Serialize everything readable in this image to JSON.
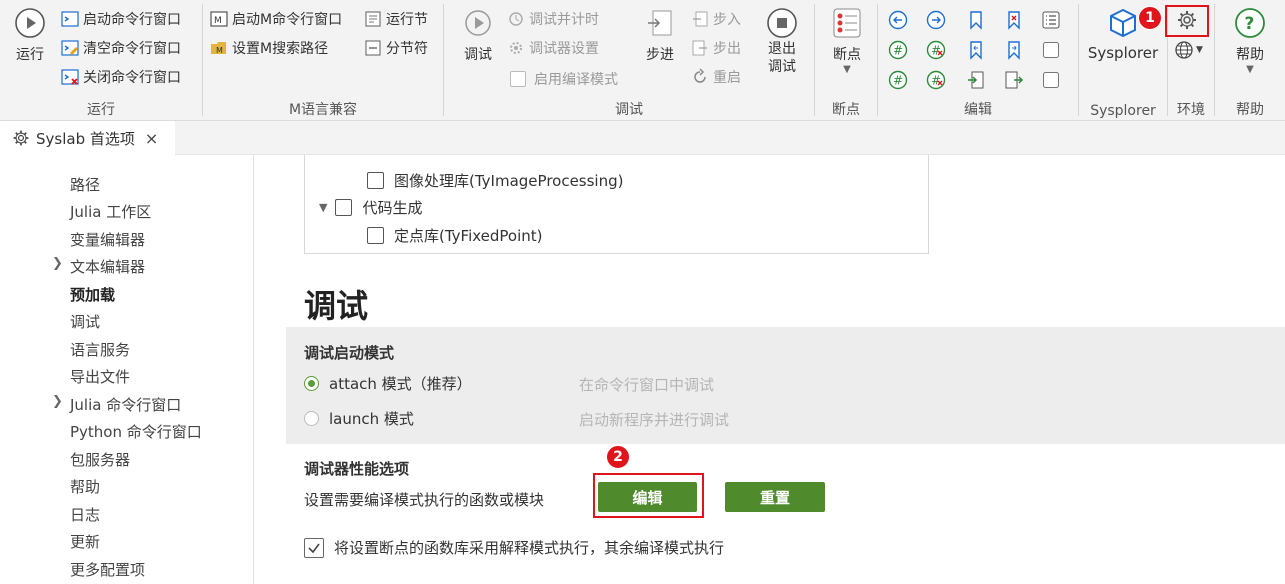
{
  "ribbon": {
    "run_group": {
      "run_label": "运行",
      "start_cmd": "启动命令行窗口",
      "clear_cmd": "清空命令行窗口",
      "close_cmd": "关闭命令行窗口",
      "group_label": "运行"
    },
    "m_group": {
      "start_m_cmd": "启动M命令行窗口",
      "run_section": "运行节",
      "set_m_path": "设置M搜索路径",
      "section_sep": "分节符",
      "group_label": "M语言兼容"
    },
    "debug_group": {
      "debug_label": "调试",
      "debug_timer": "调试并计时",
      "debugger_settings": "调试器设置",
      "enable_compile_mode": "启用编译模式",
      "step_label": "步进",
      "step_in": "步入",
      "step_out": "步出",
      "restart": "重启",
      "exit_debug": "退出\n调试",
      "group_label": "调试"
    },
    "breakpoint_group": {
      "label": "断点",
      "group_label": "断点"
    },
    "edit_group": {
      "group_label": "编辑"
    },
    "sysplorer_group": {
      "label": "Sysplorer",
      "group_label": "Sysplorer"
    },
    "env_group": {
      "group_label": "环境"
    },
    "help_group": {
      "label": "帮助",
      "group_label": "帮助"
    },
    "badges": {
      "one": "1",
      "two": "2"
    }
  },
  "tab": {
    "title": "Syslab 首选项",
    "close": "×"
  },
  "sidebar": {
    "items": [
      {
        "label": "路径"
      },
      {
        "label": "Julia 工作区"
      },
      {
        "label": "变量编辑器"
      },
      {
        "label": "文本编辑器"
      },
      {
        "label": "预加载"
      },
      {
        "label": "调试"
      },
      {
        "label": "语言服务"
      },
      {
        "label": "导出文件"
      },
      {
        "label": "Julia 命令行窗口"
      },
      {
        "label": "Python 命令行窗口"
      },
      {
        "label": "包服务器"
      },
      {
        "label": "帮助"
      },
      {
        "label": "日志"
      },
      {
        "label": "更新"
      },
      {
        "label": "更多配置项"
      }
    ]
  },
  "main": {
    "tree": {
      "image_lib": "图像处理库(TyImageProcessing)",
      "codegen": "代码生成",
      "fixed_point": "定点库(TyFixedPoint)"
    },
    "section_title": "调试",
    "debug_start_mode": {
      "heading": "调试启动模式",
      "attach_label": "attach 模式（推荐）",
      "attach_desc": "在命令行窗口中调试",
      "launch_label": "launch 模式",
      "launch_desc": "启动新程序并进行调试"
    },
    "perf": {
      "heading": "调试器性能选项",
      "desc": "设置需要编译模式执行的函数或模块",
      "edit_button": "编辑",
      "reset_button": "重置"
    },
    "interpret_checkbox": "将设置断点的函数库采用解释模式执行，其余编译模式执行"
  },
  "colors": {
    "accent_green": "#4f8a2c",
    "highlight_red": "#e0151c",
    "icon_blue": "#1f6fd0"
  }
}
